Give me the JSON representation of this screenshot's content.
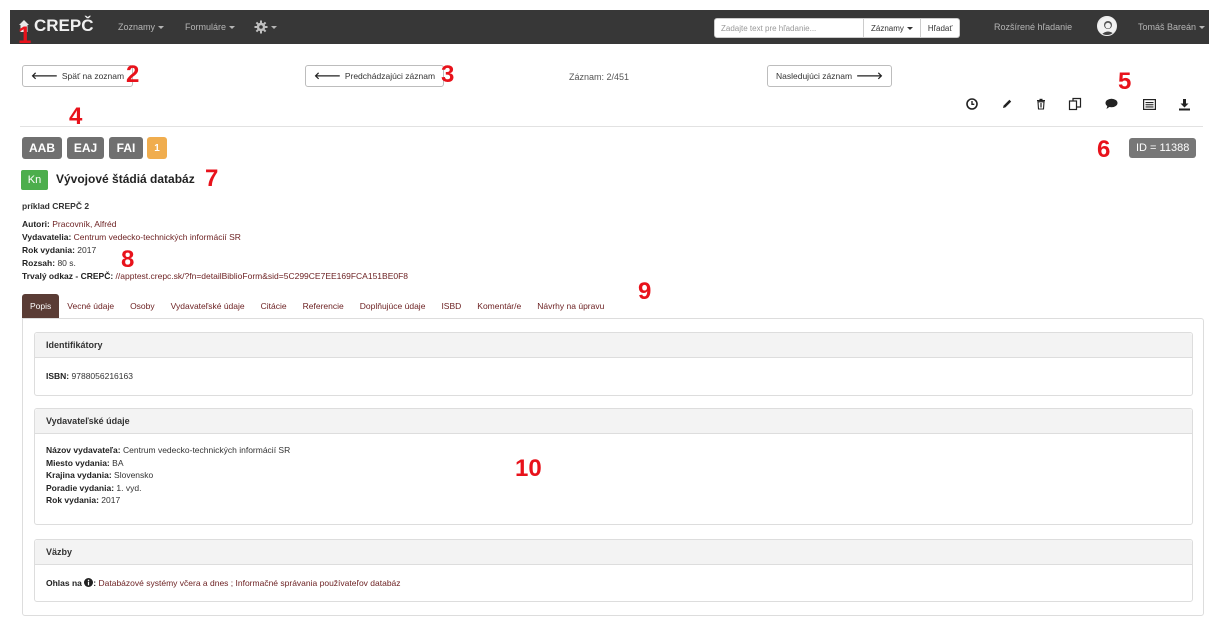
{
  "navbar": {
    "brand": "CREPČ",
    "menu_zoznamy": "Zoznamy",
    "menu_formulare": "Formuláre",
    "search_placeholder": "Zadajte text pre hľadanie...",
    "search_scope": "Záznamy",
    "search_button": "Hľadať",
    "advanced_search": "Rozšírené hľadanie",
    "user_name": "Tomáš Bareán"
  },
  "toolbar": {
    "back_label": "Späť na zoznam",
    "prev_label": "Predchádzajúci záznam",
    "counter": "Záznam: 2/451",
    "next_label": "Nasledujúci záznam"
  },
  "actions": [
    "clock-icon",
    "pencil-icon",
    "trash-icon",
    "copy-icon",
    "comment-icon",
    "list-icon",
    "download-icon"
  ],
  "badges": [
    "AAB",
    "EAJ",
    "FAI",
    "1"
  ],
  "record_id": "ID = 11388",
  "record": {
    "type_badge": "Kn",
    "title": "Vývojové štádiá databáz",
    "subtitle": "príklad CREPČ 2",
    "authors_label": "Autori:",
    "authors": "Pracovník, Alfréd",
    "publishers_label": "Vydavatelia:",
    "publishers": "Centrum vedecko-technických informácií SR",
    "year_label": "Rok vydania:",
    "year": "2017",
    "extent_label": "Rozsah:",
    "extent": "80 s.",
    "link_label": "Trvalý odkaz - CREPČ:",
    "link": "//apptest.crepc.sk/?fn=detailBiblioForm&sid=5C299CE7EE169FCA151BE0F8"
  },
  "tabs": [
    "Popis",
    "Vecné údaje",
    "Osoby",
    "Vydavateľské údaje",
    "Citácie",
    "Referencie",
    "Doplňujúce údaje",
    "ISBD",
    "Komentár/e",
    "Návrhy na úpravu"
  ],
  "panels": {
    "identifiers": {
      "title": "Identifikátory",
      "isbn_label": "ISBN:",
      "isbn": "9788056216163"
    },
    "publisher": {
      "title": "Vydavateľské údaje",
      "name_label": "Názov vydavateľa:",
      "name": "Centrum vedecko-technických informácií SR",
      "place_label": "Miesto vydania:",
      "place": "BA",
      "country_label": "Krajina vydania:",
      "country": "Slovensko",
      "edition_label": "Poradie vydania:",
      "edition": "1. vyd.",
      "year_label": "Rok vydania:",
      "year": "2017"
    },
    "links": {
      "title": "Väzby",
      "ohlas_label": "Ohlas na",
      "ohlas_value": "Databázové systémy včera a dnes ; Informačné správania používateľov databáz"
    }
  },
  "annotations": [
    "1",
    "2",
    "3",
    "4",
    "5",
    "6",
    "7",
    "8",
    "9",
    "10"
  ]
}
